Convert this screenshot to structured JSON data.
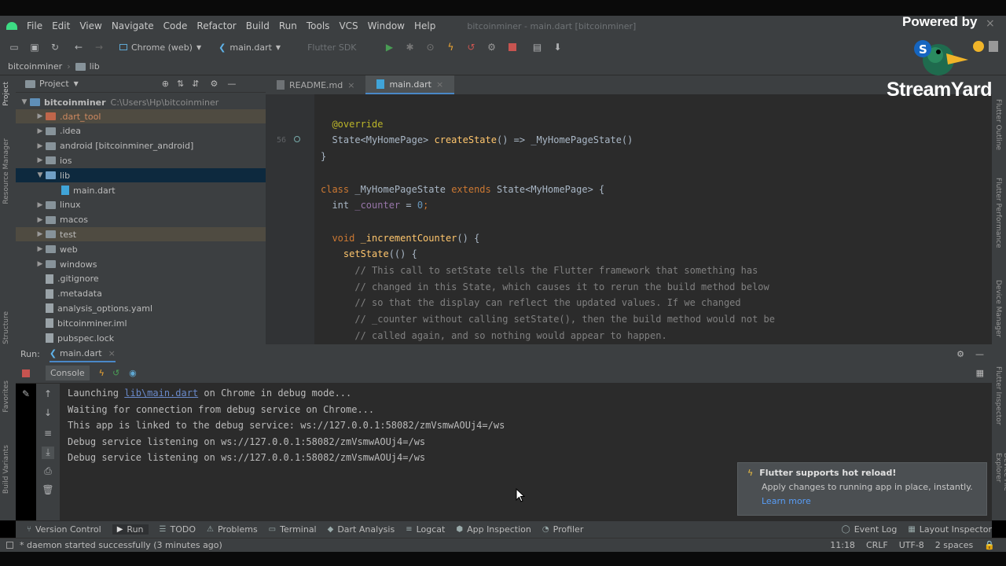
{
  "menu": [
    "File",
    "Edit",
    "View",
    "Navigate",
    "Code",
    "Refactor",
    "Build",
    "Run",
    "Tools",
    "VCS",
    "Window",
    "Help"
  ],
  "window_title": "bitcoinminer - main.dart [bitcoinminer]",
  "toolbar": {
    "device": "Chrome (web)",
    "run_config": "main.dart",
    "sdk_selector": "Flutter SDK"
  },
  "breadcrumb": [
    "bitcoinminer",
    "lib"
  ],
  "project_panel": {
    "title": "Project",
    "root": {
      "name": "bitcoinminer",
      "path": "C:\\Users\\Hp\\bitcoinminer"
    },
    "items": [
      {
        "label": ".dart_tool",
        "kind": "folder",
        "depth": 1,
        "expandable": true
      },
      {
        "label": ".idea",
        "kind": "folder",
        "depth": 1,
        "expandable": true
      },
      {
        "label": "android [bitcoinminer_android]",
        "kind": "folder",
        "depth": 1,
        "expandable": true
      },
      {
        "label": "ios",
        "kind": "folder",
        "depth": 1,
        "expandable": true
      },
      {
        "label": "lib",
        "kind": "folder",
        "depth": 1,
        "expandable": true,
        "expanded": true,
        "selected": true
      },
      {
        "label": "main.dart",
        "kind": "file",
        "depth": 2,
        "expandable": false
      },
      {
        "label": "linux",
        "kind": "folder",
        "depth": 1,
        "expandable": true
      },
      {
        "label": "macos",
        "kind": "folder",
        "depth": 1,
        "expandable": true
      },
      {
        "label": "test",
        "kind": "folder",
        "depth": 1,
        "expandable": true
      },
      {
        "label": "web",
        "kind": "folder",
        "depth": 1,
        "expandable": true
      },
      {
        "label": "windows",
        "kind": "folder",
        "depth": 1,
        "expandable": true
      },
      {
        "label": ".gitignore",
        "kind": "file",
        "depth": 1,
        "expandable": false
      },
      {
        "label": ".metadata",
        "kind": "file",
        "depth": 1,
        "expandable": false
      },
      {
        "label": "analysis_options.yaml",
        "kind": "file",
        "depth": 1,
        "expandable": false
      },
      {
        "label": "bitcoinminer.iml",
        "kind": "file",
        "depth": 1,
        "expandable": false
      },
      {
        "label": "pubspec.lock",
        "kind": "file",
        "depth": 1,
        "expandable": false
      }
    ]
  },
  "editor_tabs": [
    {
      "label": "README.md",
      "active": false
    },
    {
      "label": "main.dart",
      "active": true
    }
  ],
  "code": [
    {
      "ln": "",
      "parts": [
        {
          "t": "",
          "c": ""
        }
      ]
    },
    {
      "ln": "",
      "parts": [
        {
          "t": "  @override",
          "c": "ann"
        }
      ]
    },
    {
      "ln": "56",
      "parts": [
        {
          "t": "  State<MyHomePage> ",
          "c": ""
        },
        {
          "t": "createState",
          "c": "fn"
        },
        {
          "t": "() => _MyHomePageState()",
          "c": ""
        }
      ]
    },
    {
      "ln": "",
      "parts": [
        {
          "t": "}",
          "c": ""
        }
      ]
    },
    {
      "ln": "",
      "parts": [
        {
          "t": "",
          "c": ""
        }
      ]
    },
    {
      "ln": "",
      "parts": [
        {
          "t": "class ",
          "c": "kw"
        },
        {
          "t": "_MyHomePageState ",
          "c": ""
        },
        {
          "t": "extends ",
          "c": "kw"
        },
        {
          "t": "State<MyHomePage> {",
          "c": ""
        }
      ]
    },
    {
      "ln": "",
      "parts": [
        {
          "t": "  int ",
          "c": ""
        },
        {
          "t": "_counter",
          "c": "fld"
        },
        {
          "t": " = ",
          "c": ""
        },
        {
          "t": "0",
          "c": "num"
        },
        {
          "t": ";",
          "c": "kw"
        }
      ]
    },
    {
      "ln": "",
      "parts": [
        {
          "t": "",
          "c": ""
        }
      ]
    },
    {
      "ln": "",
      "parts": [
        {
          "t": "  void ",
          "c": "kw"
        },
        {
          "t": "_incrementCounter",
          "c": "fn"
        },
        {
          "t": "() {",
          "c": ""
        }
      ]
    },
    {
      "ln": "",
      "parts": [
        {
          "t": "    setState",
          "c": "fn"
        },
        {
          "t": "(() {",
          "c": ""
        }
      ]
    },
    {
      "ln": "",
      "parts": [
        {
          "t": "      // This call to setState tells the Flutter framework that something has",
          "c": "cm"
        }
      ]
    },
    {
      "ln": "",
      "parts": [
        {
          "t": "      // changed in this State, which causes it to rerun the build method below",
          "c": "cm"
        }
      ]
    },
    {
      "ln": "",
      "parts": [
        {
          "t": "      // so that the display can reflect the updated values. If we changed",
          "c": "cm"
        }
      ]
    },
    {
      "ln": "",
      "parts": [
        {
          "t": "      // _counter without calling setState(), then the build method would not be",
          "c": "cm"
        }
      ]
    },
    {
      "ln": "",
      "parts": [
        {
          "t": "      // called again, and so nothing would appear to happen.",
          "c": "cm"
        }
      ]
    }
  ],
  "run_panel": {
    "label": "Run:",
    "config": "main.dart",
    "console_tab": "Console"
  },
  "console": [
    {
      "pre": "Launching ",
      "link": "lib\\main.dart",
      "post": " on Chrome in debug mode..."
    },
    {
      "pre": "Waiting for connection from debug service on Chrome...",
      "link": "",
      "post": ""
    },
    {
      "pre": "This app is linked to the debug service: ws://127.0.0.1:58082/zmVsmwAOUj4=/ws",
      "link": "",
      "post": ""
    },
    {
      "pre": "Debug service listening on ws://127.0.0.1:58082/zmVsmwAOUj4=/ws",
      "link": "",
      "post": ""
    },
    {
      "pre": "Debug service listening on ws://127.0.0.1:58082/zmVsmwAOUj4=/ws",
      "link": "",
      "post": ""
    }
  ],
  "notification": {
    "title": "Flutter supports hot reload!",
    "body": "Apply changes to running app in place, instantly.",
    "link": "Learn more"
  },
  "bottom_tools": [
    {
      "label": "Version Control",
      "icon": "branch-icon"
    },
    {
      "label": "Run",
      "icon": "play-icon"
    },
    {
      "label": "TODO",
      "icon": "list-icon"
    },
    {
      "label": "Problems",
      "icon": "warning-icon"
    },
    {
      "label": "Terminal",
      "icon": "terminal-icon"
    },
    {
      "label": "Dart Analysis",
      "icon": "dart-icon"
    },
    {
      "label": "Logcat",
      "icon": "logcat-icon"
    },
    {
      "label": "App Inspection",
      "icon": "inspect-icon"
    },
    {
      "label": "Profiler",
      "icon": "profiler-icon"
    }
  ],
  "right_tools": [
    {
      "label": "Event Log",
      "icon": "chat-icon"
    },
    {
      "label": "Layout Inspector",
      "icon": "layout-icon"
    }
  ],
  "status": {
    "message": "* daemon started successfully (3 minutes ago)",
    "position": "11:18",
    "line_sep": "CRLF",
    "encoding": "UTF-8",
    "indent": "2 spaces"
  },
  "overlay": {
    "powered_by": "Powered by",
    "brand": "StreamYard"
  },
  "side_tabs": {
    "left": [
      "Project",
      "Resource Manager",
      "Structure",
      "Favorites",
      "Build Variants"
    ],
    "right": [
      "Flutter Outline",
      "Flutter Performance",
      "Device Manager",
      "Flutter Inspector",
      "Device File Explorer"
    ]
  },
  "colors": {
    "accent": "#4a88c7",
    "stop_red": "#c75450",
    "run_green": "#499c54",
    "selection": "#0d293e"
  }
}
